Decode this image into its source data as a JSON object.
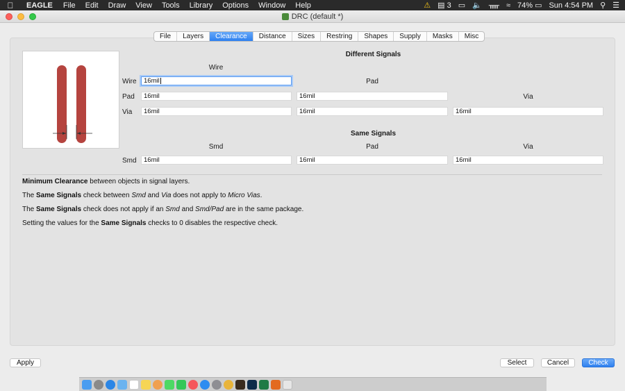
{
  "menubar": {
    "app_name": "EAGLE",
    "items": [
      "File",
      "Edit",
      "Draw",
      "View",
      "Tools",
      "Library",
      "Options",
      "Window",
      "Help"
    ],
    "status": {
      "notif_count": "3",
      "battery": "74%",
      "clock": "Sun 4:54 PM"
    }
  },
  "window": {
    "title": "DRC (default *)"
  },
  "tabs": [
    "File",
    "Layers",
    "Clearance",
    "Distance",
    "Sizes",
    "Restring",
    "Shapes",
    "Supply",
    "Masks",
    "Misc"
  ],
  "active_tab": "Clearance",
  "different_signals": {
    "heading": "Different Signals",
    "col_wire": "Wire",
    "col_pad": "Pad",
    "col_via": "Via",
    "row_wire": "Wire",
    "row_pad": "Pad",
    "row_via": "Via",
    "wire_wire": "16mil",
    "pad_wire": "16mil",
    "pad_pad": "16mil",
    "via_wire": "16mil",
    "via_pad": "16mil",
    "via_via": "16mil"
  },
  "same_signals": {
    "heading": "Same Signals",
    "col_smd": "Smd",
    "col_pad": "Pad",
    "col_via": "Via",
    "row_smd": "Smd",
    "smd_smd": "16mil",
    "smd_pad": "16mil",
    "smd_via": "16mil"
  },
  "help": {
    "line1_bold": "Minimum Clearance",
    "line1_rest": " between objects in signal layers.",
    "line2_a": "The ",
    "line2_bold": "Same Signals",
    "line2_b": " check between ",
    "line2_i1": "Smd",
    "line2_c": " and ",
    "line2_i2": "Via",
    "line2_d": " does not apply to ",
    "line2_i3": "Micro Vias",
    "line2_e": ".",
    "line3_a": "The ",
    "line3_bold": "Same Signals",
    "line3_b": " check does not apply if an ",
    "line3_i1": "Smd",
    "line3_c": " and ",
    "line3_i2": "Smd/Pad",
    "line3_d": " are in the same package.",
    "line4_a": "Setting the values for the ",
    "line4_bold": "Same Signals",
    "line4_b": " checks to 0 disables the respective check."
  },
  "buttons": {
    "apply": "Apply",
    "select": "Select",
    "cancel": "Cancel",
    "check": "Check"
  },
  "colors": {
    "accent": "#2e80f0",
    "trace": "#b5443f"
  },
  "dock_icons": [
    "finder-icon",
    "launchpad-icon",
    "safari-icon",
    "mail-icon",
    "calendar-icon",
    "notes-icon",
    "photos-icon",
    "messages-icon",
    "facetime-icon",
    "music-icon",
    "appstore-icon",
    "settings-icon",
    "chrome-icon",
    "illustrator-icon",
    "photoshop-icon",
    "excel-icon",
    "eagle-icon",
    "trash-icon"
  ]
}
